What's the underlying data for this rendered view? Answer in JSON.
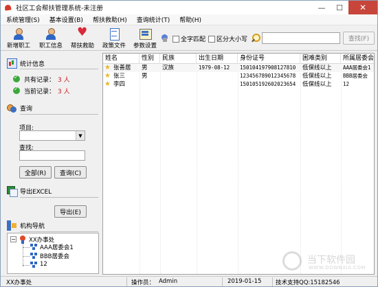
{
  "window": {
    "title": "社区工会帮扶管理系统-未注册"
  },
  "menu": [
    "系统管理(S)",
    "基本设置(B)",
    "帮扶救助(H)",
    "查询统计(T)",
    "帮助(H)"
  ],
  "toolbar": {
    "tools": [
      "新增职工",
      "职工信息",
      "帮扶救助",
      "政策文件",
      "参数设置"
    ],
    "full_match_label": "全字匹配",
    "case_label": "区分大小写",
    "search_value": "",
    "search_button": "查找(F)"
  },
  "left": {
    "stats_title": "统计信息",
    "total_label": "共有记录：",
    "total_value": "3 人",
    "current_label": "当前记录：",
    "current_value": "3 人",
    "query_title": "查询",
    "item_label": "项目:",
    "item_value": "",
    "find_label": "查找:",
    "find_value": "",
    "all_button": "全部(R)",
    "query_button": "查询(C)",
    "export_title": "导出EXCEL",
    "export_button": "导出(E)",
    "org_title": "机构导航",
    "tree": {
      "root": "XX办事处",
      "children": [
        "AAA居委会1",
        "BBB居委会",
        "12"
      ]
    }
  },
  "grid": {
    "columns": [
      "姓名",
      "性别",
      "民族",
      "出生日期",
      "身份证号",
      "困难类别",
      "所属居委会"
    ],
    "rows": [
      [
        "张善居",
        "男",
        "汉族",
        "1979-08-12",
        "150104197908127810",
        "低保线以上",
        "AAA居委会1"
      ],
      [
        "张三",
        "男",
        "",
        "",
        "123456789012345678",
        "低保线以上",
        "BBB居委会"
      ],
      [
        "李四",
        "",
        "",
        "",
        "150105192602023654",
        "低保线以上",
        "12"
      ]
    ]
  },
  "status": {
    "office": "XX办事处",
    "operator_label": "操作员：",
    "operator": "Admin",
    "date": "2019-01-15",
    "support": "技术支持QQ:15182546"
  },
  "watermark": {
    "text": "当下软件园",
    "sub": "WWW.DOWNXIA.COM"
  },
  "colors": {
    "accent_red": "#c81818",
    "close_button": "#c7453a",
    "star": "#e8b820"
  }
}
